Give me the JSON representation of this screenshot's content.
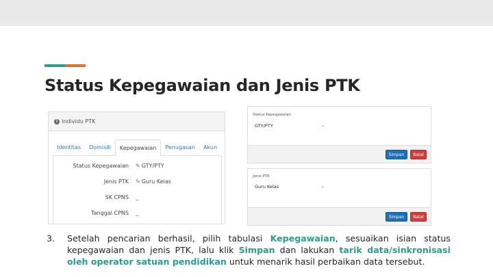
{
  "slide": {
    "title": "Status Kepegawaian dan Jenis PTK",
    "accent_colors": [
      "#2a9d8f",
      "#e76f2b"
    ]
  },
  "panel_left": {
    "header": "Individu PTK",
    "header_icon": "info-icon",
    "tabs": [
      {
        "label": "Identitas",
        "active": false
      },
      {
        "label": "Domisili",
        "active": false
      },
      {
        "label": "Kepegawaian",
        "active": true
      },
      {
        "label": "Penugasan",
        "active": false
      },
      {
        "label": "Akun",
        "active": false
      }
    ],
    "fields": [
      {
        "label": "Status Kepegawaian",
        "value": "GTY/PTY",
        "icon": "edit-icon"
      },
      {
        "label": "Jenis PTK",
        "value": "Guru Kelas",
        "icon": "edit-icon"
      },
      {
        "label": "SK CPNS",
        "value": "_"
      },
      {
        "label": "Tanggal CPNS",
        "value": "_"
      }
    ]
  },
  "panel_status": {
    "label": "Status Kepegawaian",
    "selected": "GTY/PTY",
    "save_label": "Simpan",
    "cancel_label": "Batal"
  },
  "panel_jenis": {
    "label": "Jenis PTK",
    "selected": "Guru Kelas",
    "save_label": "Simpan",
    "cancel_label": "Batal"
  },
  "instruction": {
    "number": "3.",
    "parts": [
      {
        "text": "Setelah pencarian berhasil, pilih tabulasi ",
        "highlight": false
      },
      {
        "text": "Kepegawaian",
        "highlight": true
      },
      {
        "text": ", sesuaikan isian status kepegawaian dan jenis PTK, lalu klik ",
        "highlight": false
      },
      {
        "text": "Simpan",
        "highlight": true
      },
      {
        "text": " dan lakukan ",
        "highlight": false
      },
      {
        "text": "tarik data/sinkronisasi oleh operator satuan pendidikan",
        "highlight": true
      },
      {
        "text": " untuk menarik hasil perbaikan data tersebut.",
        "highlight": false
      }
    ]
  }
}
